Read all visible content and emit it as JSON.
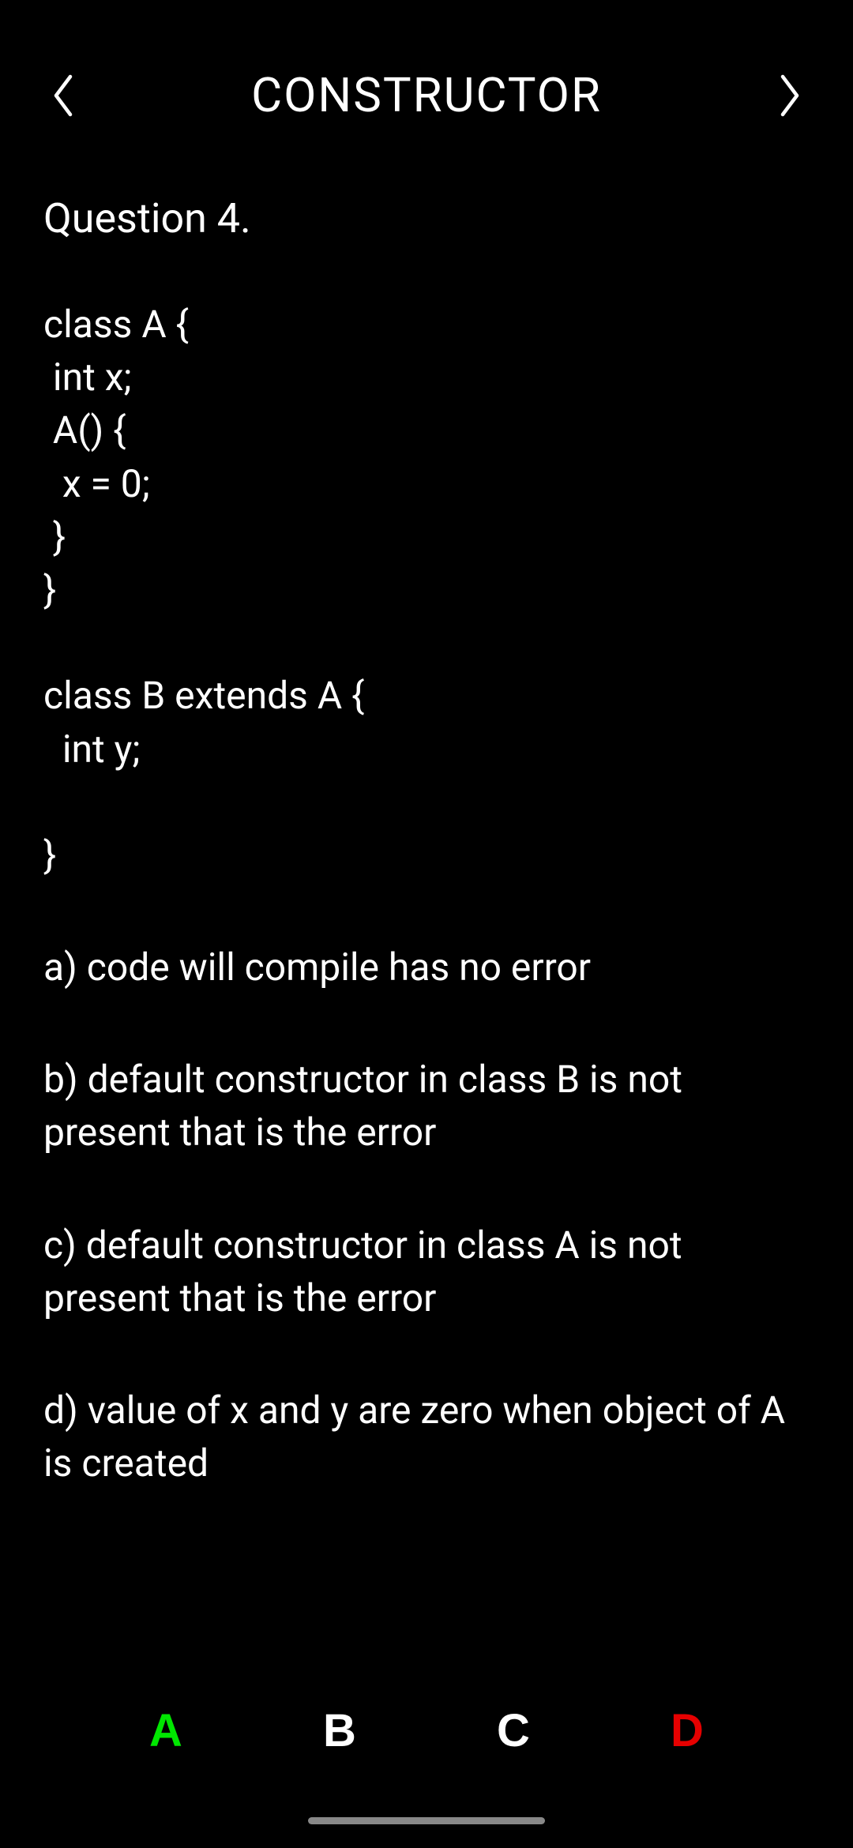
{
  "header": {
    "title": "CONSTRUCTOR"
  },
  "question": {
    "label": "Question 4.",
    "code": "class A {\n int x;\n A() {\n  x = 0;\n }\n}\n\nclass B extends A {\n  int y;\n\n}",
    "options": {
      "a": "a)  code will compile has no error",
      "b": "b)  default constructor in class B is not present that is the error",
      "c": "c)  default constructor in class A is not present that is the error",
      "d": "d)  value of x and y are zero when object of A is created"
    }
  },
  "answers": {
    "a": "A",
    "b": "B",
    "c": "C",
    "d": "D"
  }
}
